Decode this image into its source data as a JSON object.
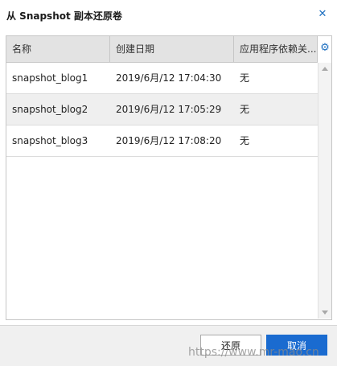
{
  "dialog": {
    "title": "从 Snapshot 副本还原卷",
    "close_icon": "close-icon"
  },
  "table": {
    "columns": [
      "名称",
      "创建日期",
      "应用程序依赖关..."
    ],
    "settings_icon": "gear-icon",
    "rows": [
      {
        "name": "snapshot_blog1",
        "date": "2019/6月/12 17:04:30",
        "dependency": "无"
      },
      {
        "name": "snapshot_blog2",
        "date": "2019/6月/12 17:05:29",
        "dependency": "无"
      },
      {
        "name": "snapshot_blog3",
        "date": "2019/6月/12 17:08:20",
        "dependency": "无"
      }
    ]
  },
  "footer": {
    "restore_label": "还原",
    "cancel_label": "取消"
  },
  "watermark": "https://www.mr-mao.cn",
  "colors": {
    "accent": "#1a6bd0",
    "header_bg": "#e3e3e3",
    "row_alt_bg": "#efefef"
  }
}
